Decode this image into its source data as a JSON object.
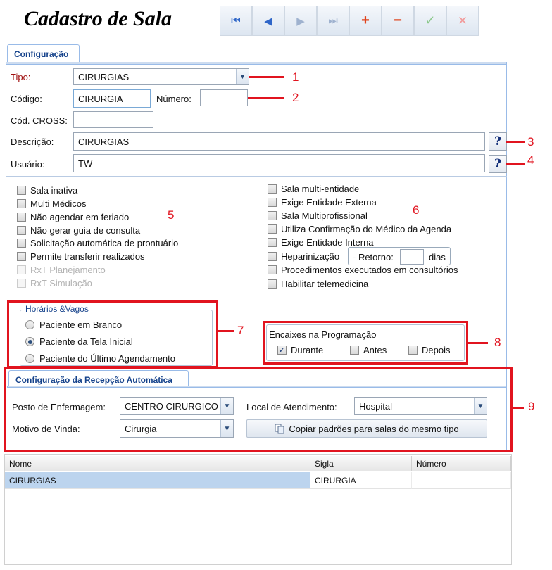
{
  "app": {
    "title": "Cadastro de Sala"
  },
  "toolbar": {
    "first_icon": "first-record-icon",
    "prev_icon": "previous-record-icon",
    "next_icon": "next-record-icon",
    "last_icon": "last-record-icon",
    "add_icon": "add-icon",
    "remove_icon": "remove-icon",
    "confirm_icon": "confirm-icon",
    "cancel_icon": "cancel-icon",
    "glyphs": {
      "first": "⏮",
      "prev": "◀",
      "next": "▶",
      "last": "⏭",
      "add": "+",
      "remove": "−",
      "confirm": "✓",
      "cancel": "✕"
    }
  },
  "tabs": {
    "main": "Configuração",
    "recepcao": "Configuração da Recepção Automática"
  },
  "form": {
    "tipo": {
      "label": "Tipo:",
      "value": "CIRURGIAS"
    },
    "codigo": {
      "label": "Código:",
      "value": "CIRURGIA"
    },
    "numero": {
      "label": "Número:",
      "value": ""
    },
    "cod_cross": {
      "label": "Cód. CROSS:",
      "value": ""
    },
    "descricao": {
      "label": "Descrição:",
      "value": "CIRURGIAS"
    },
    "usuario": {
      "label": "Usuário:",
      "value": "TW"
    },
    "help_glyph": "?"
  },
  "options_left": [
    {
      "label": "Sala inativa",
      "checked": false,
      "enabled": true
    },
    {
      "label": "Multi Médicos",
      "checked": false,
      "enabled": true
    },
    {
      "label": "Não agendar em feriado",
      "checked": false,
      "enabled": true
    },
    {
      "label": "Não gerar guia de consulta",
      "checked": false,
      "enabled": true
    },
    {
      "label": "Solicitação automática de prontuário",
      "checked": false,
      "enabled": true
    },
    {
      "label": "Permite transferir realizados",
      "checked": false,
      "enabled": true
    },
    {
      "label": "RxT Planejamento",
      "checked": false,
      "enabled": false
    },
    {
      "label": "RxT Simulação",
      "checked": false,
      "enabled": false
    }
  ],
  "options_right": [
    {
      "label": "Sala multi-entidade",
      "checked": false
    },
    {
      "label": "Exige Entidade Externa",
      "checked": false
    },
    {
      "label": "Sala Multiprofissional",
      "checked": false
    },
    {
      "label": "Utiliza Confirmação do Médico da Agenda",
      "checked": false
    },
    {
      "label": "Exige Entidade Interna",
      "checked": false
    },
    {
      "label": "Heparinização",
      "checked": false
    },
    {
      "label": "Procedimentos executados em consultórios",
      "checked": false
    },
    {
      "label": "Habilitar telemedicina",
      "checked": false
    }
  ],
  "retorno": {
    "label": "- Retorno:",
    "value": "",
    "unit": "dias"
  },
  "horarios": {
    "legend": "Horários &Vagos",
    "options": [
      {
        "label": "Paciente em Branco",
        "selected": false
      },
      {
        "label": "Paciente da Tela Inicial",
        "selected": true
      },
      {
        "label": "Paciente do Último Agendamento",
        "selected": false
      }
    ]
  },
  "encaixes": {
    "title": "Encaixes na Programação",
    "options": [
      {
        "label": "Durante",
        "checked": true
      },
      {
        "label": "Antes",
        "checked": false
      },
      {
        "label": "Depois",
        "checked": false
      }
    ]
  },
  "recepcao": {
    "posto_label": "Posto de Enfermagem:",
    "posto_value": "CENTRO CIRURGICO",
    "local_label": "Local de Atendimento:",
    "local_value": "Hospital",
    "motivo_label": "Motivo de Vinda:",
    "motivo_value": "Cirurgia",
    "copy_button": "Copiar padrões para salas do mesmo tipo"
  },
  "grid": {
    "columns": [
      "Nome",
      "Sigla",
      "Número"
    ],
    "rows": [
      {
        "nome": "CIRURGIAS",
        "sigla": "CIRURGIA",
        "numero": ""
      }
    ]
  },
  "annotations": [
    "1",
    "2",
    "3",
    "4",
    "5",
    "6",
    "7",
    "8",
    "9"
  ],
  "colors": {
    "annotation_red": "#e1141f",
    "tab_text": "#15428b",
    "selected_row": "#bcd4ee"
  }
}
